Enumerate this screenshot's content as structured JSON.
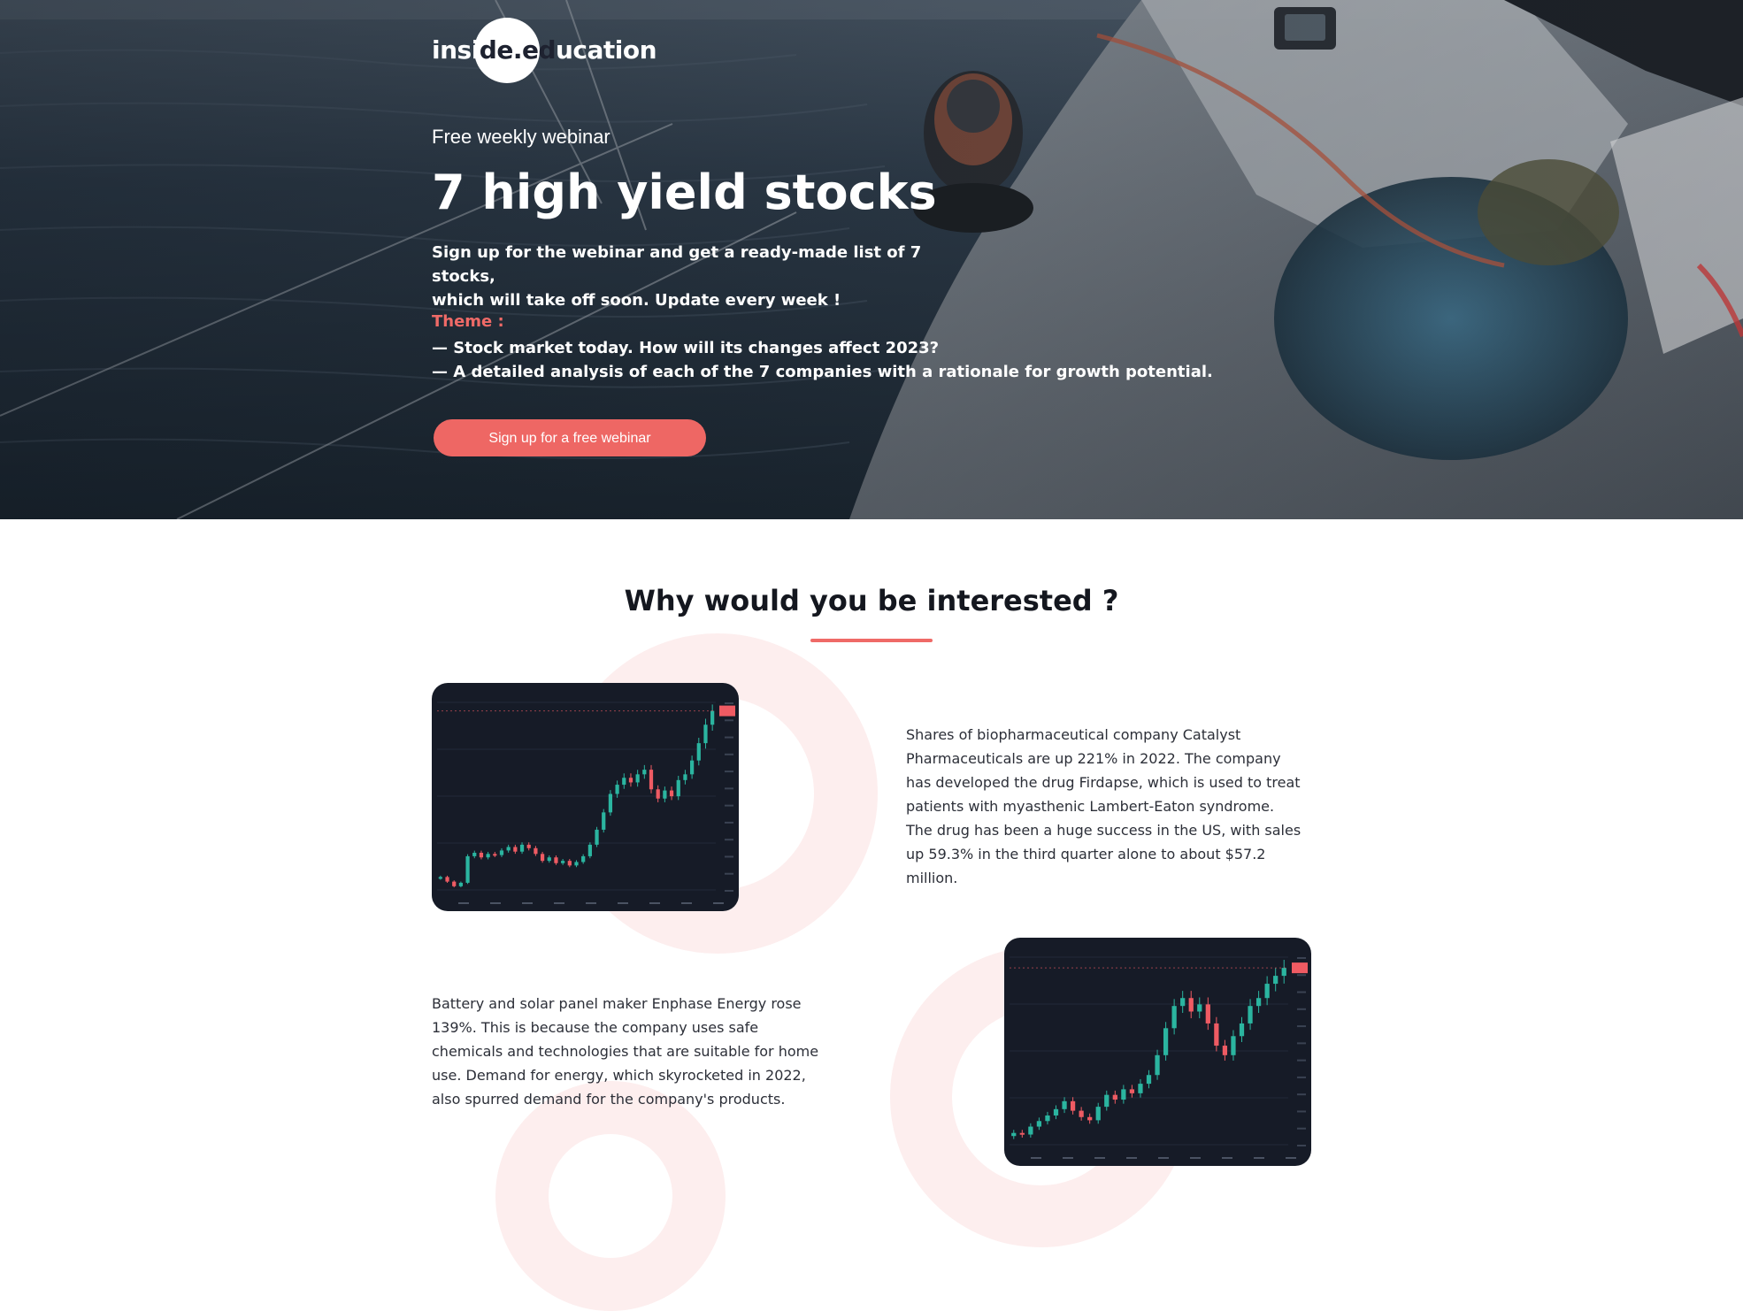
{
  "brand": {
    "logo_prefix": "insi",
    "logo_mid": "de.ed",
    "logo_suffix": "ucation"
  },
  "hero": {
    "kicker": "Free weekly webinar",
    "title": "7 high yield stocks",
    "description_line1": "Sign up for the webinar and get a ready-made list of 7 stocks,",
    "description_line2": "which will take off soon. Update every week !",
    "theme_label": "Theme :",
    "theme_items": [
      "— Stock market today. How will its changes affect 2023?",
      "— A detailed analysis of each of the 7 companies with a rationale for growth potential."
    ],
    "cta_label": "Sign up for a free webinar"
  },
  "why": {
    "title": "Why would you be interested ?",
    "items": [
      {
        "text": "Shares of biopharmaceutical company Catalyst Pharmaceuticals are up 221% in 2022. The company has developed the drug Firdapse, which is used to treat patients with myasthenic Lambert-Eaton syndrome. The drug has been a huge success in the US, with sales up 59.3% in the third quarter alone to about $57.2 million."
      },
      {
        "text": "Battery and solar panel maker Enphase Energy rose 139%. This is because the company uses safe chemicals and technologies that are suitable for home use. Demand for energy, which skyrocketed in 2022, also spurred demand for the company's products."
      }
    ]
  },
  "colors": {
    "accent": "#ee6764",
    "chart_bg": "#161b27",
    "candle_up": "#2bb5a0",
    "candle_down": "#ef5b63",
    "ring": "#fdeeee"
  },
  "chart_data": [
    {
      "type": "candlestick",
      "name": "Catalyst Pharmaceuticals",
      "up_color": "#2bb5a0",
      "down_color": "#ef5b63",
      "values": [
        4.0,
        3.6,
        3.2,
        3.5,
        5.8,
        6.1,
        5.7,
        6.0,
        5.9,
        6.3,
        6.6,
        6.2,
        6.8,
        6.5,
        6.0,
        5.4,
        5.7,
        5.2,
        5.4,
        5.0,
        5.3,
        5.8,
        6.8,
        8.1,
        9.6,
        11.2,
        12.0,
        12.6,
        12.2,
        12.9,
        13.3,
        11.6,
        10.8,
        11.5,
        11.0,
        12.4,
        12.9,
        14.1,
        15.6,
        17.2,
        18.4
      ]
    },
    {
      "type": "candlestick",
      "name": "Enphase Energy",
      "up_color": "#2bb5a0",
      "down_color": "#ef5b63",
      "values": [
        130,
        128,
        138,
        145,
        152,
        160,
        170,
        158,
        150,
        146,
        163,
        178,
        172,
        185,
        180,
        192,
        203,
        228,
        262,
        290,
        300,
        283,
        292,
        268,
        240,
        228,
        252,
        268,
        290,
        300,
        318,
        328,
        338
      ]
    }
  ]
}
